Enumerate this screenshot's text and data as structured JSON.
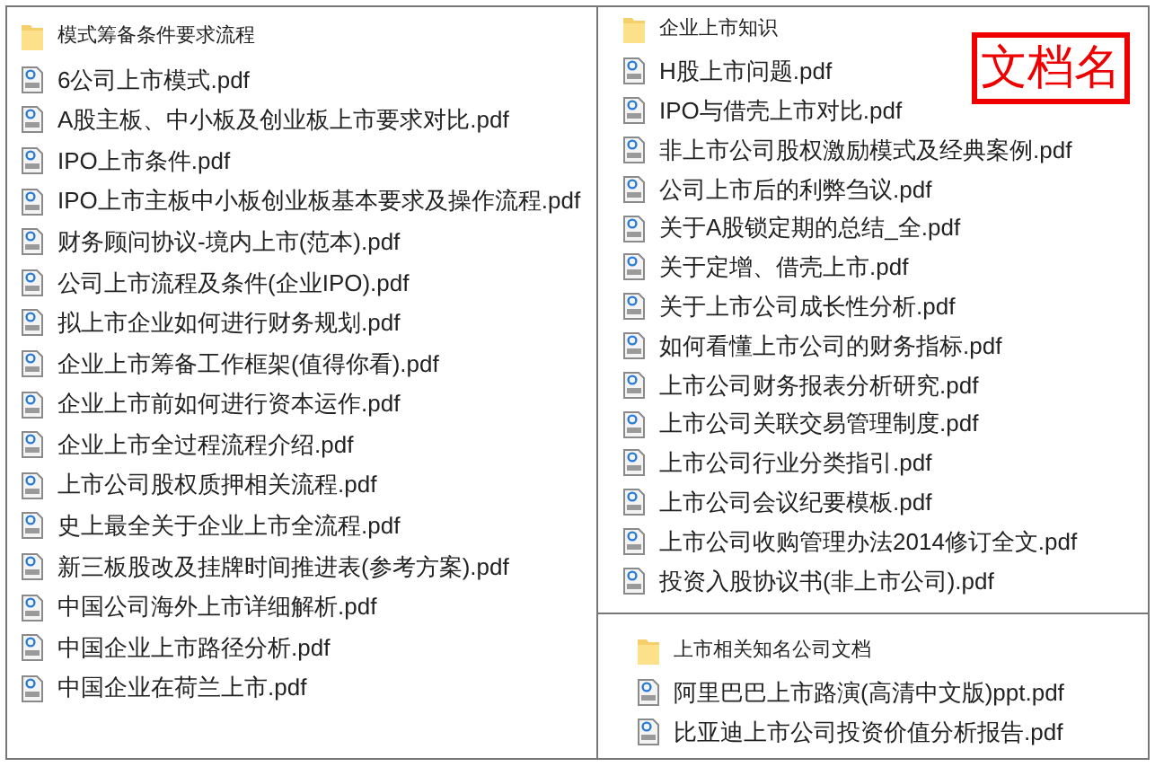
{
  "panels": [
    {
      "folder": "模式筹备条件要求流程",
      "files": [
        "6公司上市模式.pdf",
        "A股主板、中小板及创业板上市要求对比.pdf",
        "IPO上市条件.pdf",
        "IPO上市主板中小板创业板基本要求及操作流程.pdf",
        "财务顾问协议-境内上市(范本).pdf",
        "公司上市流程及条件(企业IPO).pdf",
        "拟上市企业如何进行财务规划.pdf",
        "企业上市筹备工作框架(值得你看).pdf",
        "企业上市前如何进行资本运作.pdf",
        "企业上市全过程流程介绍.pdf",
        "上市公司股权质押相关流程.pdf",
        "史上最全关于企业上市全流程.pdf",
        "新三板股改及挂牌时间推进表(参考方案).pdf",
        "中国公司海外上市详细解析.pdf",
        "中国企业上市路径分析.pdf",
        "中国企业在荷兰上市.pdf"
      ]
    },
    {
      "folder": "企业上市知识",
      "annotation": "文档名",
      "files": [
        "H股上市问题.pdf",
        "IPO与借壳上市对比.pdf",
        "非上市公司股权激励模式及经典案例.pdf",
        "公司上市后的利弊刍议.pdf",
        "关于A股锁定期的总结_全.pdf",
        "关于定增、借壳上市.pdf",
        "关于上市公司成长性分析.pdf",
        "如何看懂上市公司的财务指标.pdf",
        "上市公司财务报表分析研究.pdf",
        "上市公司关联交易管理制度.pdf",
        "上市公司行业分类指引.pdf",
        "上市公司会议纪要模板.pdf",
        "上市公司收购管理办法2014修订全文.pdf",
        "投资入股协议书(非上市公司).pdf"
      ]
    },
    {
      "folder": "上市相关知名公司文档",
      "files": [
        "阿里巴巴上市路演(高清中文版)ppt.pdf",
        "比亚迪上市公司投资价值分析报告.pdf"
      ]
    }
  ]
}
